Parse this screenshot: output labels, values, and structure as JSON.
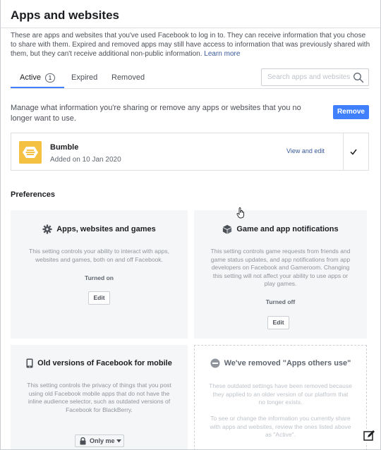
{
  "header": {
    "title": "Apps and websites"
  },
  "intro": {
    "text": "These are apps and websites that you've used Facebook to log in to. They can receive information that you chose to share with them. Expired and removed apps may still have access to information that was previously shared with them, but they can't receive additional non-public information.",
    "learn_more": "Learn more"
  },
  "tabs": {
    "active_label": "Active",
    "active_count": "1",
    "expired_label": "Expired",
    "removed_label": "Removed"
  },
  "search": {
    "placeholder": "Search apps and websites"
  },
  "manage": {
    "text": "Manage what information you're sharing or remove any apps or websites that you no longer want to use.",
    "remove_label": "Remove"
  },
  "apps": [
    {
      "name": "Bumble",
      "added": "Added on 10 Jan 2020",
      "view_edit": "View and edit",
      "checked": true
    }
  ],
  "preferences": {
    "title": "Preferences",
    "cards": [
      {
        "title": "Apps, websites and games",
        "icon": "gear-icon",
        "body": "This setting controls your ability to interact with apps, websites and games, both on and off Facebook.",
        "status": "Turned on",
        "edit_label": "Edit"
      },
      {
        "title": "Game and app notifications",
        "icon": "cube-icon",
        "body": "This setting controls game requests from friends and game status updates, and app notifications from app developers on Facebook and Gameroom. Changing this setting will not affect your ability to use apps or play games.",
        "status": "Turned off",
        "edit_label": "Edit"
      },
      {
        "title": "Old versions of Facebook for mobile",
        "icon": "mobile-phone-icon",
        "body": "This setting controls the privacy of things that you post using old Facebook mobile apps that do not have the inline audience selector, such as outdated versions of Facebook for BlackBerry.",
        "audience_label": "Only me"
      },
      {
        "title": "We've removed \"Apps others use\"",
        "icon": "minus-circle-icon",
        "body1": "These outdated settings have been removed because they applied to an older version of our platform that no longer exists.",
        "body2": "To see or change the information you currently share with apps and websites, review the ones listed above as \"Active\"."
      }
    ]
  },
  "colors": {
    "accent": "#4080ff",
    "link": "#385898",
    "bumble_yellow": "#f5c142"
  }
}
